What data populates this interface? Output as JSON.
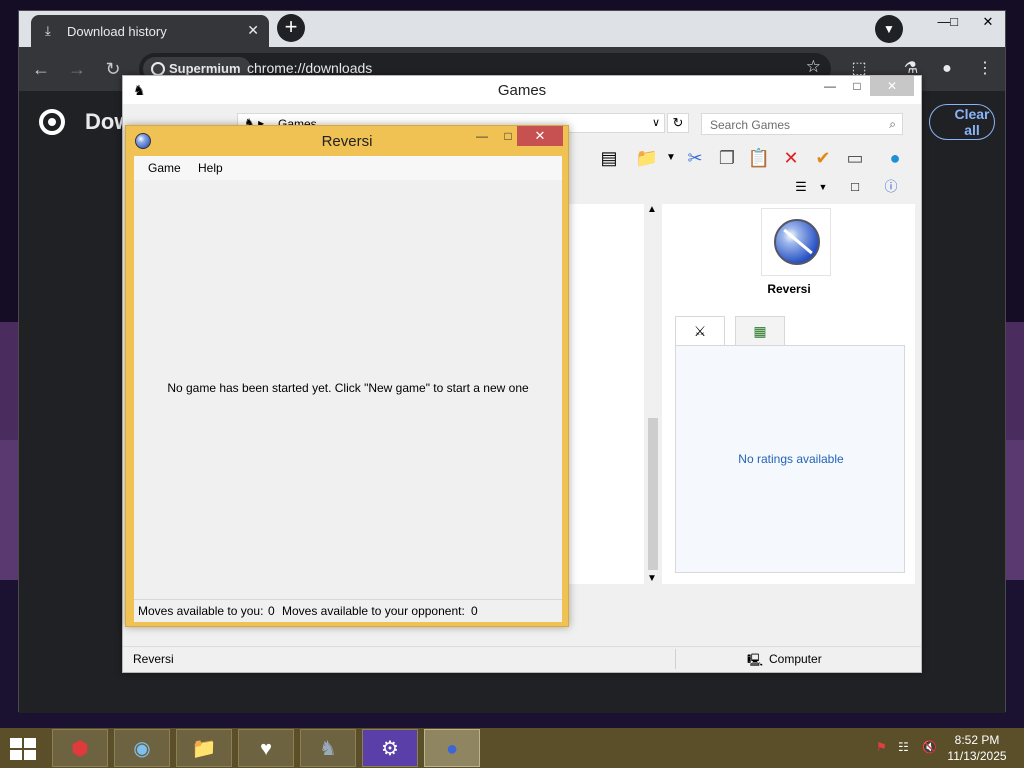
{
  "chrome": {
    "tab_title": "Download history",
    "omnibox_chip": "Supermium",
    "url": "chrome://downloads",
    "page_title": "Dow",
    "clear_all": "Clear all"
  },
  "explorer": {
    "title": "Games",
    "address": "Games",
    "search_placeholder": "Search Games",
    "preview_name": "Reversi",
    "ratings_text": "No ratings available",
    "status_left": "Reversi",
    "status_right": "Computer"
  },
  "reversi": {
    "title": "Reversi",
    "menu": [
      "Game",
      "Help"
    ],
    "message": "No game has been started yet. Click \"New game\" to start a new one",
    "status_you": "Moves available to you:",
    "moves_you": "0",
    "status_opponent": "Moves available to your opponent:",
    "moves_opponent": "0"
  },
  "taskbar": {
    "time": "8:52 PM",
    "date": "11/13/2025",
    "icons": [
      "toolbox-icon",
      "browser-icon",
      "file-explorer-icon",
      "heart-app-icon",
      "chess-icon",
      "settings-gear-icon",
      "reversi-icon"
    ]
  }
}
